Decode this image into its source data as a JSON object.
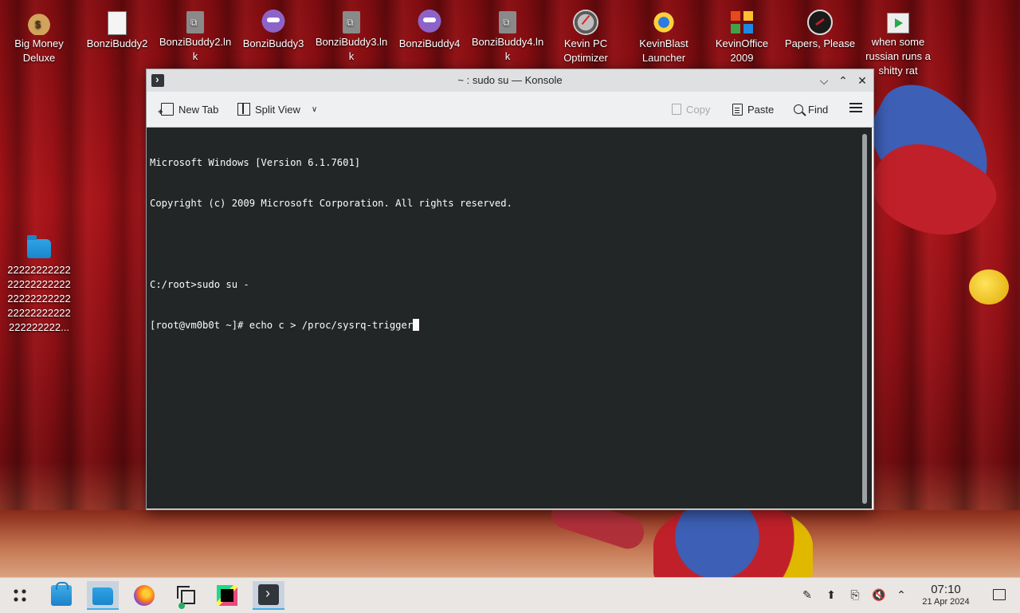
{
  "desktop": {
    "icons": [
      {
        "label": "Big Money Deluxe",
        "icon": "money-bag-icon"
      },
      {
        "label": "BonziBuddy2",
        "icon": "document-icon"
      },
      {
        "label": "BonziBuddy2.lnk",
        "icon": "shortcut-file-icon"
      },
      {
        "label": "BonziBuddy3",
        "icon": "bonzi-gorilla-icon"
      },
      {
        "label": "BonziBuddy3.lnk",
        "icon": "shortcut-file-icon"
      },
      {
        "label": "BonziBuddy4",
        "icon": "bonzi-gorilla-icon"
      },
      {
        "label": "BonziBuddy4.lnk",
        "icon": "shortcut-file-icon"
      },
      {
        "label": "Kevin PC Optimizer",
        "icon": "gauge-icon"
      },
      {
        "label": "KevinBlast Launcher",
        "icon": "blast-icon"
      },
      {
        "label": "KevinOffice 2009",
        "icon": "office-icon"
      },
      {
        "label": "Papers, Please",
        "icon": "papers-please-icon"
      },
      {
        "label": "when some russian runs a shitty rat",
        "icon": "video-file-icon"
      }
    ],
    "folder": {
      "label": "22222222222 22222222222 22222222222 22222222222 222222222...",
      "icon": "folder-icon"
    }
  },
  "window": {
    "title": "~ : sudo su — Konsole",
    "toolbar": {
      "new_tab": "New Tab",
      "split_view": "Split View",
      "copy": "Copy",
      "paste": "Paste",
      "find": "Find"
    },
    "terminal": {
      "lines": [
        "Microsoft Windows [Version 6.1.7601]",
        "Copyright (c) 2009 Microsoft Corporation. All rights reserved.",
        "",
        "C:/root>sudo su -",
        "[root@vm0b0t ~]# echo c > /proc/sysrq-trigger"
      ]
    }
  },
  "taskbar": {
    "apps": [
      {
        "name": "Discover",
        "icon": "store-icon"
      },
      {
        "name": "Dolphin",
        "icon": "folder-icon"
      },
      {
        "name": "Firefox",
        "icon": "firefox-icon"
      },
      {
        "name": "Window switcher",
        "icon": "windows-icon"
      },
      {
        "name": "PyCharm",
        "icon": "pycharm-icon"
      },
      {
        "name": "Konsole",
        "icon": "konsole-icon",
        "active": true
      }
    ],
    "clock": {
      "time": "07:10",
      "date": "21 Apr 2024"
    }
  },
  "colors": {
    "terminal_bg": "#232627",
    "terminal_fg": "#fcfcfc",
    "accent": "#3daee9",
    "titlebar": "#dee0e2"
  }
}
